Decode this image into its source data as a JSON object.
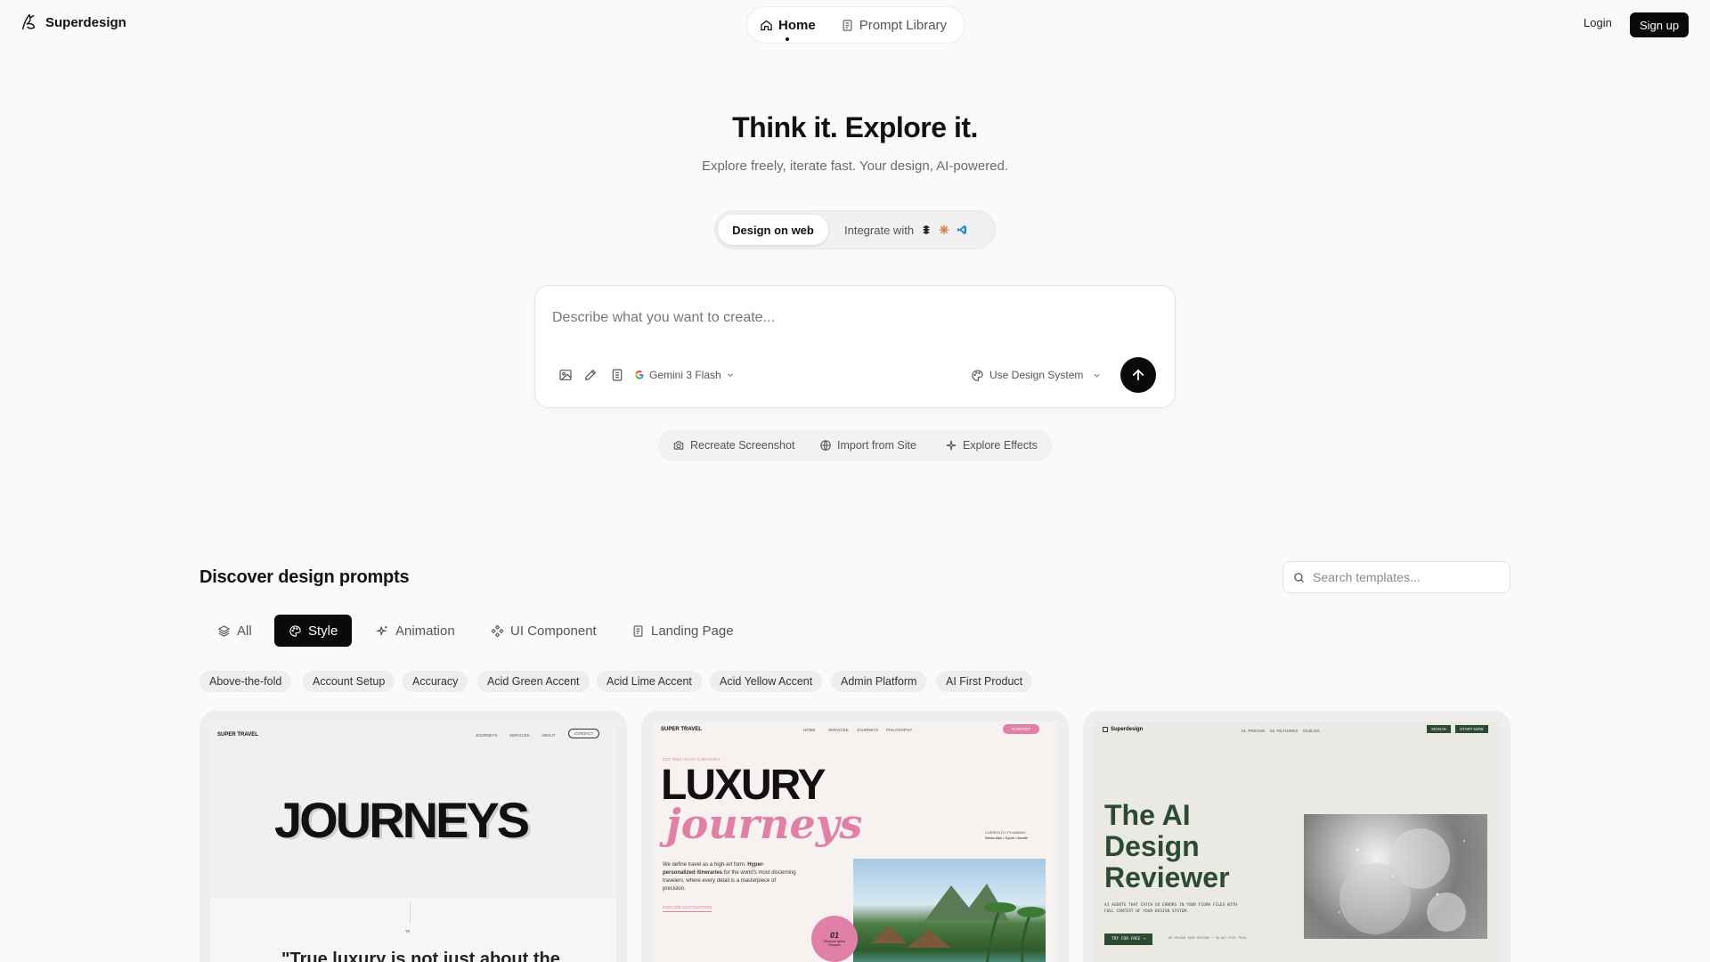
{
  "brand": {
    "name": "Superdesign"
  },
  "nav": {
    "items": [
      {
        "label": "Home",
        "icon": "home-icon",
        "active": true
      },
      {
        "label": "Prompt Library",
        "icon": "document-icon",
        "active": false
      }
    ],
    "login": "Login",
    "signup": "Sign up"
  },
  "hero": {
    "title": "Think it. Explore it.",
    "subtitle": "Explore freely, iterate fast. Your design, AI-powered.",
    "modes": {
      "web": "Design on web",
      "integrate": "Integrate with"
    }
  },
  "prompt": {
    "placeholder": "Describe what you want to create...",
    "model": "Gemini 3 Flash",
    "design_system": "Use Design System"
  },
  "quick_actions": [
    {
      "label": "Recreate Screenshot",
      "icon": "camera-icon"
    },
    {
      "label": "Import from Site",
      "icon": "globe-icon"
    },
    {
      "label": "Explore Effects",
      "icon": "sparkle-icon"
    }
  ],
  "discover": {
    "title": "Discover design prompts",
    "search_placeholder": "Search templates...",
    "categories": [
      {
        "label": "All",
        "icon": "layers-icon",
        "active": false
      },
      {
        "label": "Style",
        "icon": "palette-icon",
        "active": true
      },
      {
        "label": "Animation",
        "icon": "sparkle-icon",
        "active": false
      },
      {
        "label": "UI Component",
        "icon": "component-icon",
        "active": false
      },
      {
        "label": "Landing Page",
        "icon": "document-icon",
        "active": false
      }
    ],
    "tags": [
      "Above-the-fold",
      "Account Setup",
      "Accuracy",
      "Acid Green Accent",
      "Acid Lime Accent",
      "Acid Yellow Accent",
      "Admin Platform",
      "AI First Product"
    ]
  },
  "cards": [
    {
      "brand": "SUPER TRAVEL",
      "nav": [
        "JOURNEYS",
        "SERVICES",
        "ABOUT"
      ],
      "cta": "CONTACT",
      "headline": "JOURNEYS",
      "quote": "\"True luxury is not just about the"
    },
    {
      "brand": "SUPER TRAVEL",
      "nav": [
        "HOME",
        "SERVICES",
        "JOURNEYS",
        "PHILOSOPHY"
      ],
      "cta": "CONTACT",
      "eyebrow": "EST. 2024 / ELITE CURATIONS",
      "headline1": "LUXURY",
      "headline2": "journeys",
      "aside1": "CURRENTLY PLANNING",
      "aside2": "Swiss Alps • Kyoto • Amalfi",
      "body_a": "We define travel as a high-art form. ",
      "body_b": "Hyper-personalized itineraries",
      "body_c": " for the world's most discerning travelers, where every detail is a masterpiece of precision.",
      "link": "EXPLORE DESTINATIONS",
      "badge_num": "01",
      "badge_text": "Premium Island Escapes"
    },
    {
      "brand": "Superdesign",
      "nav": [
        "01. PRICING",
        "02. FEATURES",
        "03.BLOG"
      ],
      "btn_in": "SIGN IN",
      "btn_start": "START NOW",
      "h1": "The AI",
      "h2": "Design",
      "h3": "Reviewer",
      "body": "AI AGENTS THAT CATCH UX ERRORS IN YOUR FIGMA FILES WITH FULL CONTEXT OF YOUR DESIGN SYSTEM.",
      "cta": "TRY FOR FREE →",
      "note": "OR UPLOAD YOUR DESIGNS • 30-DAY FREE TRIAL"
    }
  ],
  "colors": {
    "accent": "#0a0a0a",
    "pink": "#e07fa8",
    "green": "#2d4a33"
  }
}
